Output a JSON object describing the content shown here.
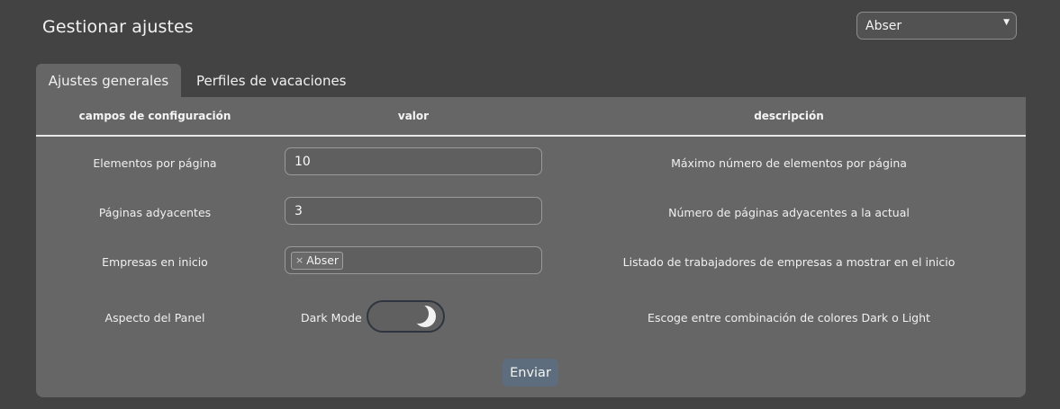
{
  "header": {
    "title": "Gestionar ajustes",
    "company_select": {
      "value": "Abser",
      "caret": "▼"
    }
  },
  "tabs": [
    {
      "label": "Ajustes generales",
      "active": true
    },
    {
      "label": "Perfiles de vacaciones",
      "active": false
    }
  ],
  "table": {
    "columns": [
      "campos de configuración",
      "valor",
      "descripción"
    ],
    "rows": [
      {
        "label": "Elementos por página",
        "value": "10",
        "description": "Máximo número de elementos por página"
      },
      {
        "label": "Páginas adyacentes",
        "value": "3",
        "description": "Número de páginas adyacentes a la actual"
      },
      {
        "label": "Empresas en inicio",
        "chip": "Abser",
        "chip_remove": "×",
        "description": "Listado de trabajadores de empresas a mostrar en el inicio"
      },
      {
        "label": "Aspecto del Panel",
        "toggle_label": "Dark Mode",
        "toggle_state": "dark",
        "description": "Escoge entre combinación de colores Dark o Light"
      }
    ]
  },
  "submit_label": "Enviar",
  "colors": {
    "background": "#434343",
    "panel": "#666666",
    "submit": "#5d6d7d"
  },
  "icons": {
    "toggle": "moon-icon",
    "select": "caret-down-icon",
    "chip_remove": "close-icon"
  }
}
